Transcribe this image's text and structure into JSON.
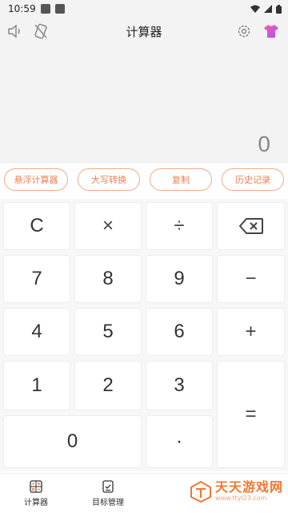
{
  "status": {
    "time": "10:59"
  },
  "header": {
    "title": "计算器"
  },
  "display": {
    "value": "0"
  },
  "chips": [
    "悬浮计算器",
    "大写转换",
    "复制",
    "历史记录"
  ],
  "keys": {
    "clear": "C",
    "multiply": "×",
    "divide": "÷",
    "seven": "7",
    "eight": "8",
    "nine": "9",
    "minus": "−",
    "four": "4",
    "five": "5",
    "six": "6",
    "plus": "+",
    "one": "1",
    "two": "2",
    "three": "3",
    "equals": "=",
    "zero": "0",
    "dot": "·"
  },
  "nav": {
    "calculator": "计算器",
    "goals": "目标管理"
  },
  "watermark": {
    "title": "天天游戏网",
    "url": "www.ttyl23.com"
  },
  "colors": {
    "accent": "#f08050",
    "chip_border": "#f3a98a"
  }
}
